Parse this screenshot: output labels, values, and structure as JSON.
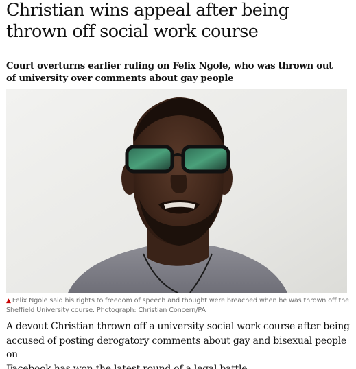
{
  "article": {
    "headline_line1": "Christian wins appeal after being",
    "headline_line2": "thrown off social work course",
    "standfirst_line1": "Court overturns earlier ruling on Felix Ngole, who was thrown out",
    "standfirst_line2": "of university over comments about gay people",
    "caption_line1": "Felix Ngole said his rights to freedom of speech and thought were breached when he was thrown off the",
    "caption_line2": "Sheffield University course. Photograph: Christian Concern/PA",
    "body_line1": "A devout Christian thrown off a university social work course after being",
    "body_line2": "accused of posting derogatory comments about gay and bisexual people on",
    "body_line3": "Facebook has won the latest round of a legal battle."
  },
  "colors": {
    "caption_marker": "#c70000",
    "text": "#121212",
    "caption_text": "#707070"
  },
  "icons": {
    "caption_marker": "triangle-up-icon"
  }
}
